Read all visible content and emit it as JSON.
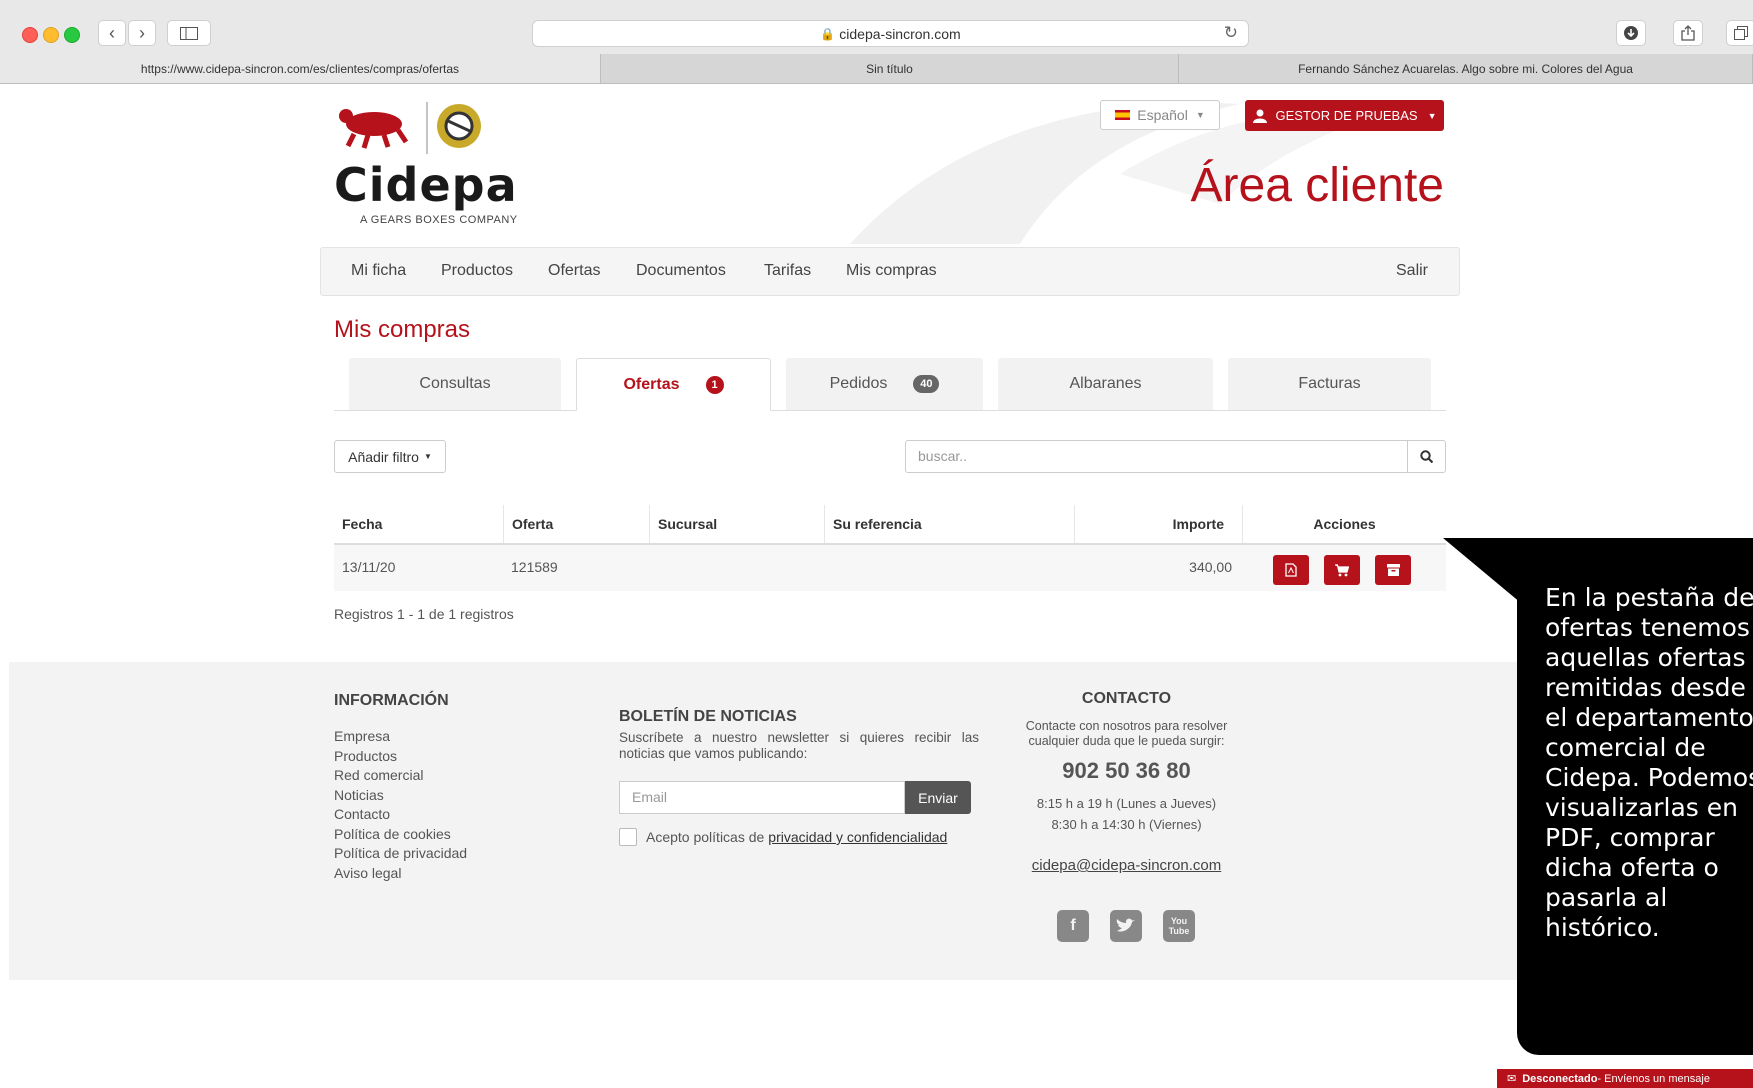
{
  "browser": {
    "url": "cidepa-sincron.com",
    "tabs": [
      "https://www.cidepa-sincron.com/es/clientes/compras/ofertas",
      "Sin título",
      "Fernando Sánchez Acuarelas. Algo sobre mi. Colores del Agua"
    ]
  },
  "header": {
    "brand": "Cidepa",
    "tagline": "A GEARS BOXES COMPANY",
    "language": "Español",
    "user": "GESTOR DE PRUEBAS",
    "area_title": "Área cliente"
  },
  "nav": {
    "items": [
      "Mi ficha",
      "Productos",
      "Ofertas",
      "Documentos",
      "Tarifas",
      "Mis compras"
    ],
    "logout": "Salir"
  },
  "main": {
    "title": "Mis compras",
    "tabs": [
      {
        "label": "Consultas",
        "badge": ""
      },
      {
        "label": "Ofertas",
        "badge": "1"
      },
      {
        "label": "Pedidos",
        "badge": "40"
      },
      {
        "label": "Albaranes",
        "badge": ""
      },
      {
        "label": "Facturas",
        "badge": ""
      }
    ],
    "filter_label": "Añadir filtro",
    "search_placeholder": "buscar..",
    "table": {
      "headers": [
        "Fecha",
        "Oferta",
        "Sucursal",
        "Su referencia",
        "Importe",
        "Acciones"
      ],
      "rows": [
        {
          "fecha": "13/11/20",
          "oferta": "121589",
          "sucursal": "",
          "referencia": "",
          "importe": "340,00"
        }
      ]
    },
    "records": "Registros 1 - 1 de 1 registros"
  },
  "footer": {
    "info_title": "INFORMACIÓN",
    "info_links": [
      "Empresa",
      "Productos",
      "Red comercial",
      "Noticias",
      "Contacto",
      "Política de cookies",
      "Política de privacidad",
      "Aviso legal"
    ],
    "news_title": "BOLETÍN DE NOTICIAS",
    "news_text": "Suscríbete a nuestro newsletter si quieres recibir las noticias que vamos publicando:",
    "email_placeholder": "Email",
    "send_label": "Enviar",
    "accept_text": "Acepto políticas de",
    "accept_link": "privacidad y confidencialidad",
    "contact_title": "CONTACTO",
    "contact_text": "Contacte con nosotros para resolver cualquier duda que le pueda surgir:",
    "phone": "902 50 36 80",
    "hours1": "8:15 h a 19 h (Lunes a Jueves)",
    "hours2": "8:30 h a 14:30 h (Viernes)",
    "email": "cidepa@cidepa-sincron.com"
  },
  "annotation": {
    "text": "En la pestaña de ofertas tenemos aquellas ofertas remitidas desde el departamento comercial de Cidepa. Podemos visualizarlas en PDF, comprar dicha oferta o pasarla al histórico."
  },
  "chat": {
    "status": "Desconectado",
    "message": " - Envíenos un mensaje"
  },
  "colors": {
    "brand_red": "#b5121b"
  }
}
